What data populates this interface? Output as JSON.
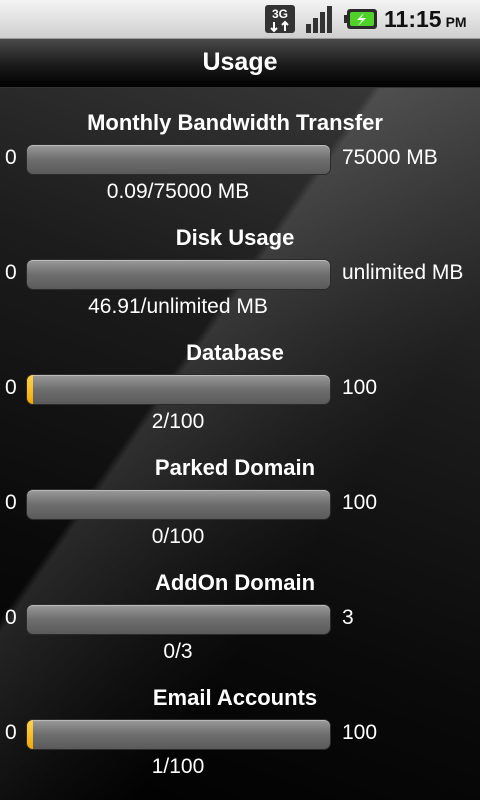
{
  "status_bar": {
    "network": "3G",
    "time": "11:15",
    "ampm": "PM",
    "icons": [
      "3g-data-icon",
      "signal-icon",
      "battery-charging-icon"
    ]
  },
  "header": {
    "title": "Usage"
  },
  "sections": [
    {
      "title": "Monthly Bandwidth Transfer",
      "min": "0",
      "max": "75000 MB",
      "usage": "0.09/75000 MB",
      "fill_fraction": 0.0
    },
    {
      "title": "Disk Usage",
      "min": "0",
      "max": "unlimited MB",
      "usage": "46.91/unlimited MB",
      "fill_fraction": 0.0
    },
    {
      "title": "Database",
      "min": "0",
      "max": "100",
      "usage": "2/100",
      "fill_fraction": 0.02
    },
    {
      "title": "Parked Domain",
      "min": "0",
      "max": "100",
      "usage": "0/100",
      "fill_fraction": 0.0
    },
    {
      "title": "AddOn Domain",
      "min": "0",
      "max": "3",
      "usage": "0/3",
      "fill_fraction": 0.0
    },
    {
      "title": "Email Accounts",
      "min": "0",
      "max": "100",
      "usage": "1/100",
      "fill_fraction": 0.01
    }
  ],
  "colors": {
    "fill": "#f2a900",
    "bar": "#6e6e6e"
  }
}
